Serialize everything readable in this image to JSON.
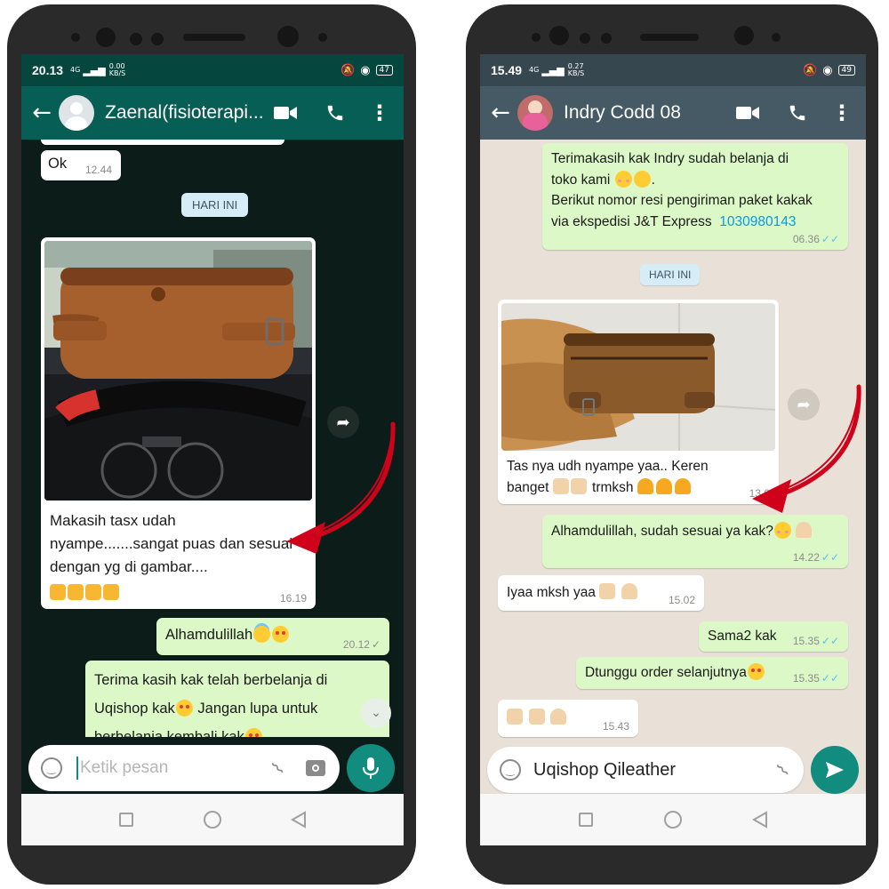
{
  "left": {
    "status": {
      "time": "20.13",
      "signal": "4G",
      "speed": "0.00",
      "speed_unit": "KB/S",
      "battery": "47"
    },
    "contact": "Zaenal(fisioterapi...",
    "messages": [
      {
        "text": "Ok",
        "time": "12.44"
      },
      {
        "date_chip": "HARI INI"
      },
      {
        "caption": "Makasih tasx udah nyampe.......sangat puas dan sesuai dengan yg di gambar....",
        "time": "16.19"
      },
      {
        "text": "Alhamdulillah",
        "time": "20.12"
      },
      {
        "text_line1": "Terima kasih kak telah berbelanja di",
        "text_line2": "Uqishop kak",
        "text_line2b": " Jangan lupa untuk",
        "text_line3": "berbelanja kembali kak"
      }
    ],
    "input_placeholder": "Ketik pesan",
    "colors": {
      "header": "#075e54",
      "chat_bg": "#0c1c18",
      "arrow": "#d0021b"
    }
  },
  "right": {
    "status": {
      "time": "15.49",
      "signal": "4G",
      "speed": "0.27",
      "speed_unit": "KB/S",
      "battery": "49"
    },
    "contact": "Indry Codd 08",
    "messages": [
      {
        "line1": "Terimakasih kak Indry sudah belanja di",
        "line2": "toko kami",
        "line3": "Berikut nomor resi pengiriman paket kakak",
        "line4": "via ekspedisi J&T Express",
        "resi": "1030980143",
        "time": "06.36"
      },
      {
        "date_chip": "HARI INI"
      },
      {
        "caption_line1": "Tas nya udh nyampe yaa.. Keren",
        "caption_line2a": "banget",
        "caption_line2b": "trmksh",
        "time": "13.0"
      },
      {
        "text": "Alhamdulillah, sudah sesuai ya kak?",
        "time": "14.22"
      },
      {
        "text": "Iyaa mksh yaa",
        "time": "15.02"
      },
      {
        "text": "Sama2 kak",
        "time": "15.35"
      },
      {
        "text": "Dtunggu order selanjutnya",
        "time": "15.35"
      },
      {
        "time": "15.43"
      }
    ],
    "input_value": "Uqishop Qileather",
    "colors": {
      "header": "#455a64",
      "chat_bg": "#e9e1d8",
      "arrow": "#d0021b"
    }
  }
}
